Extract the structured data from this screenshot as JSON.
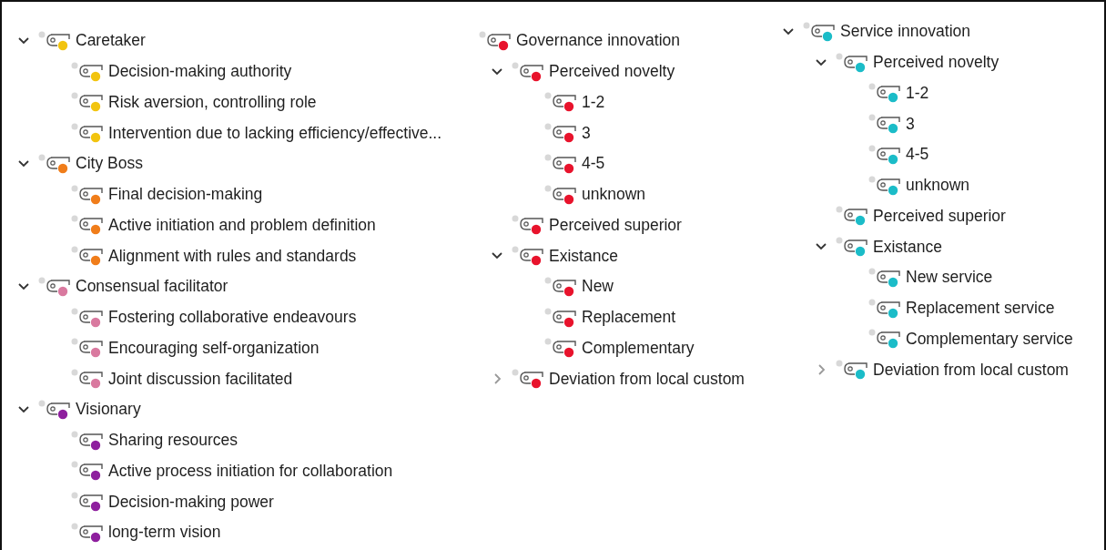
{
  "columns": [
    {
      "nodes": [
        {
          "label": "Caretaker",
          "color": "#f2c40f",
          "expanded": true,
          "children": [
            {
              "label": "Decision-making authority",
              "color": "#f2c40f"
            },
            {
              "label": "Risk aversion, controlling role",
              "color": "#f2c40f"
            },
            {
              "label": "Intervention due to lacking efficiency/effective...",
              "color": "#f2c40f"
            }
          ]
        },
        {
          "label": "City Boss",
          "color": "#f07d1a",
          "expanded": true,
          "children": [
            {
              "label": "Final decision-making",
              "color": "#f07d1a"
            },
            {
              "label": "Active initiation and problem definition",
              "color": "#f07d1a"
            },
            {
              "label": "Alignment with rules and standards",
              "color": "#f07d1a"
            }
          ]
        },
        {
          "label": "Consensual facilitator",
          "color": "#d9799f",
          "expanded": true,
          "children": [
            {
              "label": "Fostering collaborative endeavours",
              "color": "#d9799f"
            },
            {
              "label": "Encouraging self-organization",
              "color": "#d9799f"
            },
            {
              "label": "Joint discussion facilitated",
              "color": "#d9799f"
            }
          ]
        },
        {
          "label": "Visionary",
          "color": "#8e1f9e",
          "expanded": true,
          "children": [
            {
              "label": "Sharing resources",
              "color": "#8e1f9e"
            },
            {
              "label": "Active process initiation for collaboration",
              "color": "#8e1f9e"
            },
            {
              "label": "Decision-making power",
              "color": "#8e1f9e"
            },
            {
              "label": "long-term vision",
              "color": "#8e1f9e"
            }
          ]
        }
      ]
    },
    {
      "nodes": [
        {
          "label": "Governance innovation",
          "color": "#e8132c",
          "children": [
            {
              "label": "Perceived novelty",
              "color": "#e8132c",
              "expanded": true,
              "children": [
                {
                  "label": "1-2",
                  "color": "#e8132c"
                },
                {
                  "label": "3",
                  "color": "#e8132c"
                },
                {
                  "label": "4-5",
                  "color": "#e8132c"
                },
                {
                  "label": "unknown",
                  "color": "#e8132c"
                }
              ]
            },
            {
              "label": "Perceived superior",
              "color": "#e8132c"
            },
            {
              "label": "Existance",
              "color": "#e8132c",
              "expanded": true,
              "children": [
                {
                  "label": "New",
                  "color": "#e8132c"
                },
                {
                  "label": "Replacement",
                  "color": "#e8132c"
                },
                {
                  "label": "Complementary",
                  "color": "#e8132c"
                }
              ]
            },
            {
              "label": "Deviation from local custom",
              "color": "#e8132c",
              "expanded": false
            }
          ]
        }
      ]
    },
    {
      "nodes": [
        {
          "label": "Service innovation",
          "color": "#1bbcc8",
          "expanded": true,
          "children": [
            {
              "label": "Perceived novelty",
              "color": "#1bbcc8",
              "expanded": true,
              "children": [
                {
                  "label": "1-2",
                  "color": "#1bbcc8"
                },
                {
                  "label": "3",
                  "color": "#1bbcc8"
                },
                {
                  "label": "4-5",
                  "color": "#1bbcc8"
                },
                {
                  "label": "unknown",
                  "color": "#1bbcc8"
                }
              ]
            },
            {
              "label": "Perceived superior",
              "color": "#1bbcc8"
            },
            {
              "label": "Existance",
              "color": "#1bbcc8",
              "expanded": true,
              "children": [
                {
                  "label": "New service",
                  "color": "#1bbcc8"
                },
                {
                  "label": "Replacement service",
                  "color": "#1bbcc8"
                },
                {
                  "label": "Complementary service",
                  "color": "#1bbcc8"
                }
              ]
            },
            {
              "label": "Deviation from local custom",
              "color": "#1bbcc8",
              "expanded": false
            }
          ]
        }
      ]
    }
  ]
}
